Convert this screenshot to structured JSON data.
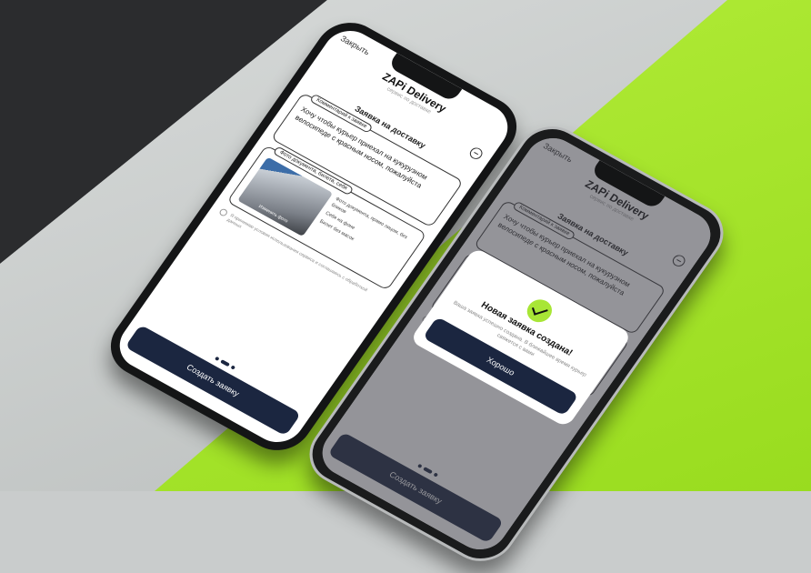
{
  "app": {
    "close_label": "Закрыть",
    "title": "ZAPi Delivery",
    "subtitle": "сервис по доставке",
    "heading": "Заявка на доставку"
  },
  "comment_card": {
    "label": "Комментарий к заявке",
    "text": "Хочу чтобы курьер приехал на кукурузном велосипеде с красным носом, пожалуйста"
  },
  "photo_card": {
    "label": "Фото документа, билета, себя",
    "thumb_caption": "Изменить фото",
    "hints": [
      "Фото документа, прямо лицом, без бликов",
      "Себя на фоне",
      "Билет без масок"
    ]
  },
  "consent_text": "Я принимаю условия использования сервиса и соглашаюсь с обработкой данных",
  "create_button": "Создать заявку",
  "modal": {
    "title": "Новая заявка создана!",
    "text": "Ваша заявка успешно создана. В ближайшее время курьер свяжется с вами",
    "ok_button": "Хорошо"
  }
}
